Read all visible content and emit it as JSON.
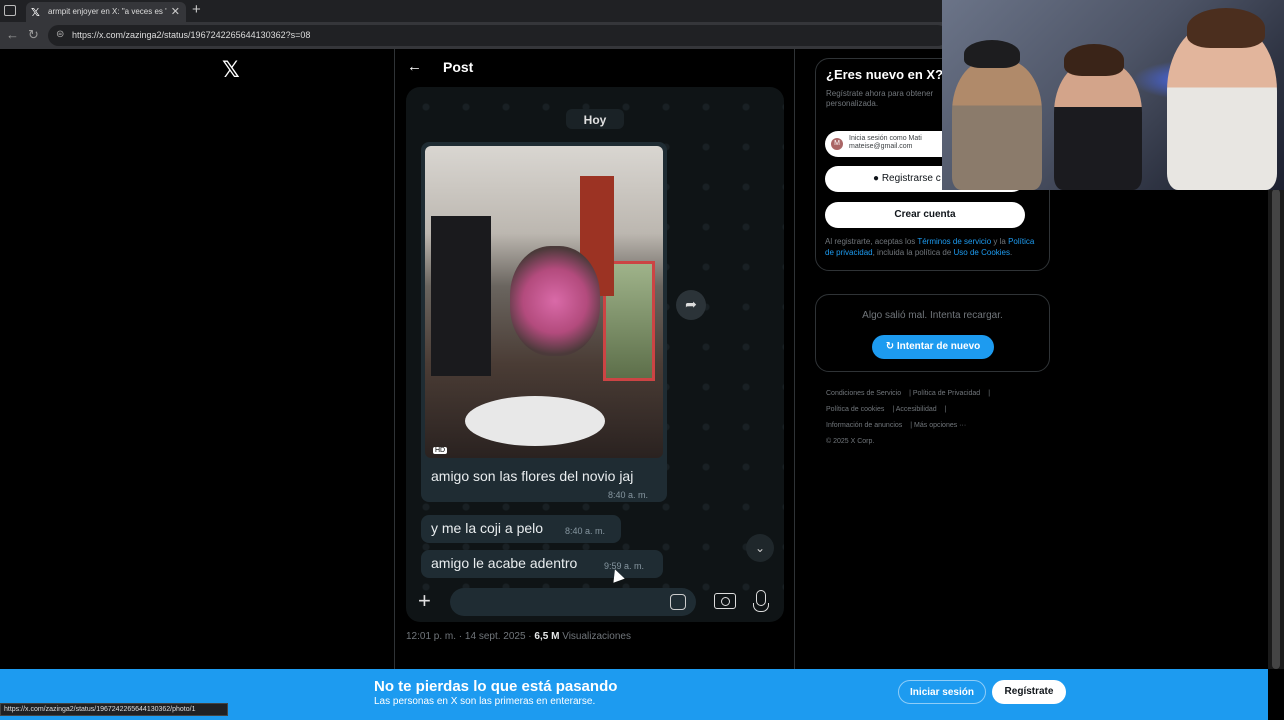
{
  "browser": {
    "tab_title": "armpit enjoyer en X: \"a veces es '",
    "url": "https://x.com/zazinga2/status/1967242265644130362?s=08",
    "status_url": "https://x.com/zazinga2/status/1967242265644130362/photo/1"
  },
  "header": {
    "title": "Post"
  },
  "chat": {
    "day_label": "Hoy",
    "messages": [
      {
        "text": "amigo son las flores del novio jaj",
        "time": "8:40 a. m."
      },
      {
        "text": "y me la coji a pelo",
        "time": "8:40 a. m."
      },
      {
        "text": "amigo le acabe adentro",
        "time": "9:59 a. m."
      }
    ],
    "hd_badge": "HD"
  },
  "post_meta": {
    "time": "12:01 p. m. · 14 sept. 2025 · ",
    "views": "6,5 M",
    "views_label": " Visualizaciones"
  },
  "signup": {
    "title": "¿Eres nuevo en X?",
    "desc": "Regístrate ahora para obtener personalizada.",
    "google_line1": "Inicia sesión como Mati",
    "google_line2": "mateise@gmail.com",
    "google_avatar": "M",
    "apple_label": "Registrarse c",
    "create_label": "Crear cuenta",
    "terms_pre": "Al registrarte, aceptas los ",
    "terms_link1": "Términos de servicio",
    "terms_mid": " y la ",
    "terms_link2": "Política de privacidad",
    "terms_mid2": ", incluida la política de ",
    "terms_link3": "Uso de Cookies",
    "terms_end": "."
  },
  "error_card": {
    "message": "Algo salió mal. Intenta recargar.",
    "retry_label": "Intentar de nuevo"
  },
  "footer": {
    "links": [
      "Condiciones de Servicio",
      "Política de Privacidad",
      "Política de cookies",
      "Accesibilidad",
      "Información de anuncios",
      "Más opciones ···",
      "© 2025 X Corp."
    ]
  },
  "banner": {
    "title": "No te pierdas lo que está pasando",
    "subtitle": "Las personas en X son las primeras en enterarse.",
    "login_label": "Iniciar sesión",
    "register_label": "Regístrate"
  }
}
